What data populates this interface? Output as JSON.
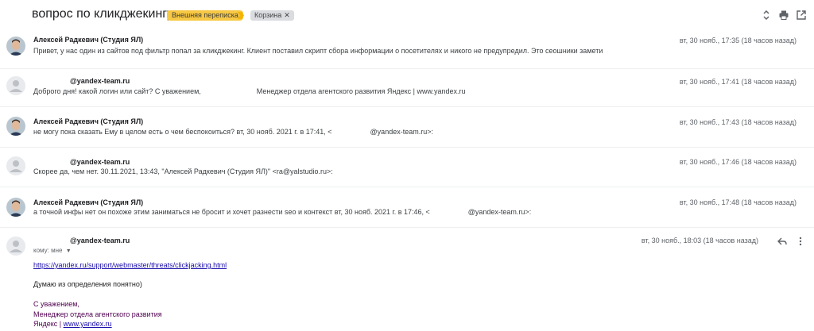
{
  "header": {
    "subject": "вопрос по кликджекингу",
    "label_external": "Внешняя переписка",
    "label_trash": "Корзина"
  },
  "messages": [
    {
      "sender": "Алексей Радкевич (Студия ЯЛ)",
      "snippet": "Привет, у нас один из сайтов под фильтр попал за кликджекинг. Клиент поставил скрипт сбора информации о посетителях и никого не предупредил. Это сеошники замети",
      "time": "вт, 30 нояб., 17:35 (18 часов назад)"
    },
    {
      "sender": "@yandex-team.ru",
      "snippet_a": "Доброго дня! какой логин или сайт? С уважением,",
      "snippet_b": "Менеджер отдела агентского развития Яндекс | www.yandex.ru",
      "time": "вт, 30 нояб., 17:41 (18 часов назад)"
    },
    {
      "sender": "Алексей Радкевич (Студия ЯЛ)",
      "snippet_a": "не могу пока сказать Ему в целом есть о чем беспокоиться? вт, 30 нояб. 2021 г. в 17:41, <",
      "snippet_b": "@yandex-team.ru>:",
      "time": "вт, 30 нояб., 17:43 (18 часов назад)"
    },
    {
      "sender": "@yandex-team.ru",
      "snippet": "Скорее да, чем нет. 30.11.2021, 13:43, \"Алексей Радкевич (Студия ЯЛ)\" <ra@yalstudio.ru>:",
      "time": "вт, 30 нояб., 17:46 (18 часов назад)"
    },
    {
      "sender": "Алексей Радкевич (Студия ЯЛ)",
      "snippet_a": "а точной инфы нет он похоже этим заниматься не бросит и хочет разнести seo и контекст вт, 30 нояб. 2021 г. в 17:46, <",
      "snippet_b": "@yandex-team.ru>:",
      "time": "вт, 30 нояб., 17:48 (18 часов назад)"
    },
    {
      "sender": "@yandex-team.ru",
      "to_me": "кому: мне",
      "time": "вт, 30 нояб., 18:03 (18 часов назад)",
      "link": "https://yandex.ru/support/webmaster/threats/clickjacking.html",
      "body": "Думаю из определения понятно)",
      "sig_line1": "С уважением,",
      "sig_line2": "Менеджер отдела агентского развития",
      "sig_line3_prefix": "Яндекс | ",
      "sig_line3_link": "www.yandex.ru"
    }
  ]
}
